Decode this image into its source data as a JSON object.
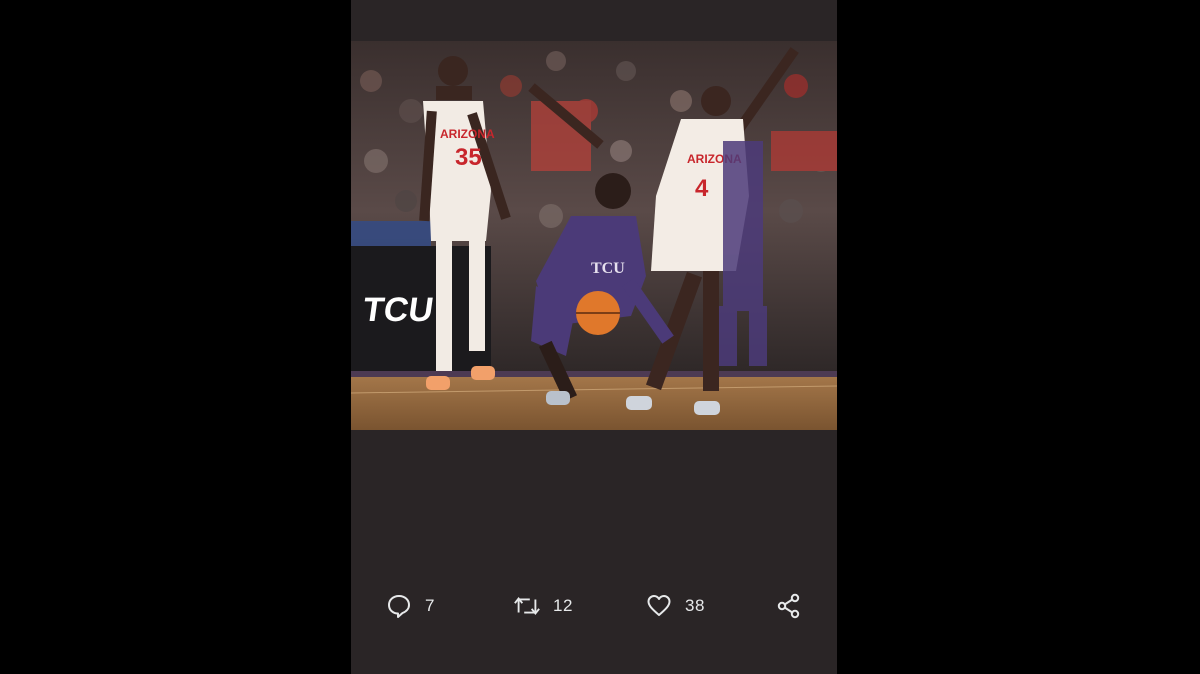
{
  "colors": {
    "background": "#000000",
    "panel": "#2a2526",
    "icon": "#e7e9ea"
  },
  "media": {
    "jersey_left_text": "ARIZONA",
    "jersey_left_number": "35",
    "jersey_right_text": "ARIZONA",
    "jersey_right_number": "4",
    "jersey_center_text": "TCU",
    "banner_text": "TCU"
  },
  "actions": {
    "reply": {
      "icon": "reply-icon",
      "count": "7"
    },
    "retweet": {
      "icon": "retweet-icon",
      "count": "12"
    },
    "like": {
      "icon": "heart-icon",
      "count": "38"
    },
    "share": {
      "icon": "share-icon"
    }
  }
}
